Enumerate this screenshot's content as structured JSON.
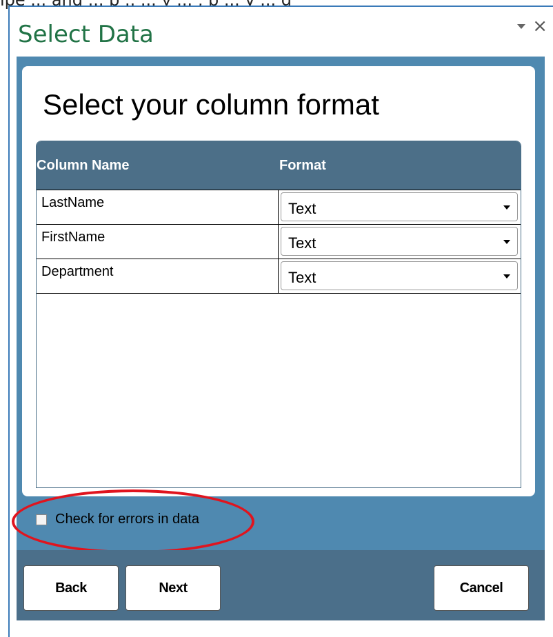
{
  "top_line_text": "ipe ... and ... b .. ... y ... , p ... y ... g",
  "pane": {
    "title": "Select Data",
    "heading": "Select your column format"
  },
  "table": {
    "headers": {
      "column_name": "Column Name",
      "format": "Format"
    },
    "rows": [
      {
        "name": "LastName",
        "format": "Text"
      },
      {
        "name": "FirstName",
        "format": "Text"
      },
      {
        "name": "Department",
        "format": "Text"
      }
    ]
  },
  "options": {
    "check_errors_label": "Check for errors in data",
    "check_errors_checked": false
  },
  "buttons": {
    "back": "Back",
    "next": "Next",
    "cancel": "Cancel"
  },
  "colors": {
    "title_green": "#217346",
    "panel_blue": "#4f89b0",
    "header_blue": "#4c6f88",
    "highlight_red": "#e0141e"
  },
  "icons": [
    "dropdown-icon",
    "close-icon",
    "select-arrow-icon"
  ]
}
